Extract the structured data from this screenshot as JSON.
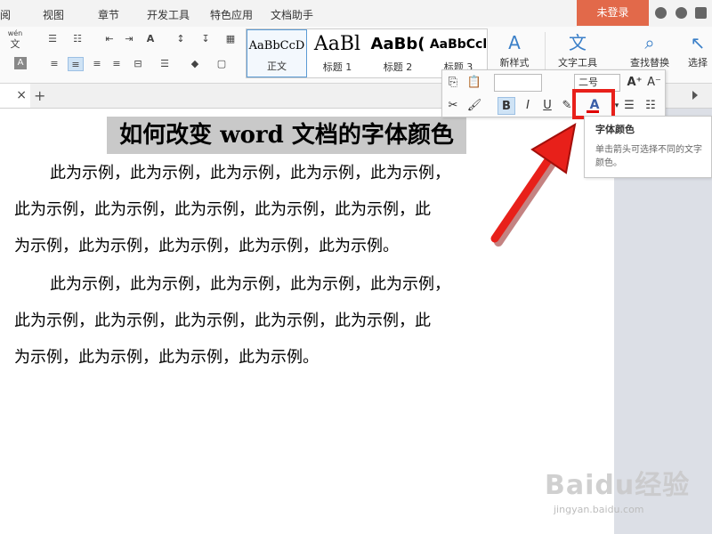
{
  "menu": {
    "items": [
      "阅",
      "视图",
      "章节",
      "开发工具",
      "特色应用",
      "文档助手"
    ],
    "login_label": "未登录"
  },
  "ribbon": {
    "font_label_top": "wén",
    "font_label_bottom": "文",
    "styles": [
      {
        "sample": "AaBbCcD",
        "name": "正文"
      },
      {
        "sample": "AaBl",
        "name": "标题 1"
      },
      {
        "sample": "AaBb(",
        "name": "标题 2"
      },
      {
        "sample": "AaBbCcl",
        "name": "标题 3"
      }
    ],
    "new_style": "新样式",
    "text_tools": "文字工具",
    "find_replace": "查找替换",
    "select": "选择"
  },
  "mini_toolbar": {
    "font_size": "二号",
    "bold": "B",
    "italic": "I",
    "underline": "U",
    "font_color": "A"
  },
  "tooltip": {
    "title": "字体颜色",
    "description": "单击箭头可选择不同的文字颜色。"
  },
  "document": {
    "title": "如何改变 word 文档的字体颜色",
    "paragraph1": [
      "此为示例，此为示例，此为示例，此为示例，此为示例，",
      "此为示例，此为示例，此为示例，此为示例，此为示例，此",
      "为示例，此为示例，此为示例，此为示例，此为示例。"
    ],
    "paragraph2": [
      "此为示例，此为示例，此为示例，此为示例，此为示例，",
      "此为示例，此为示例，此为示例，此为示例，此为示例，此",
      "为示例，此为示例，此为示例，此为示例。"
    ]
  },
  "watermark": {
    "logo": "Baidu经验",
    "url": "jingyan.baidu.com"
  },
  "colors": {
    "login_bg": "#e2694a",
    "highlight_red": "#e8201a",
    "selection_gray": "#c9c9c9",
    "font_color_red": "#e00000"
  }
}
